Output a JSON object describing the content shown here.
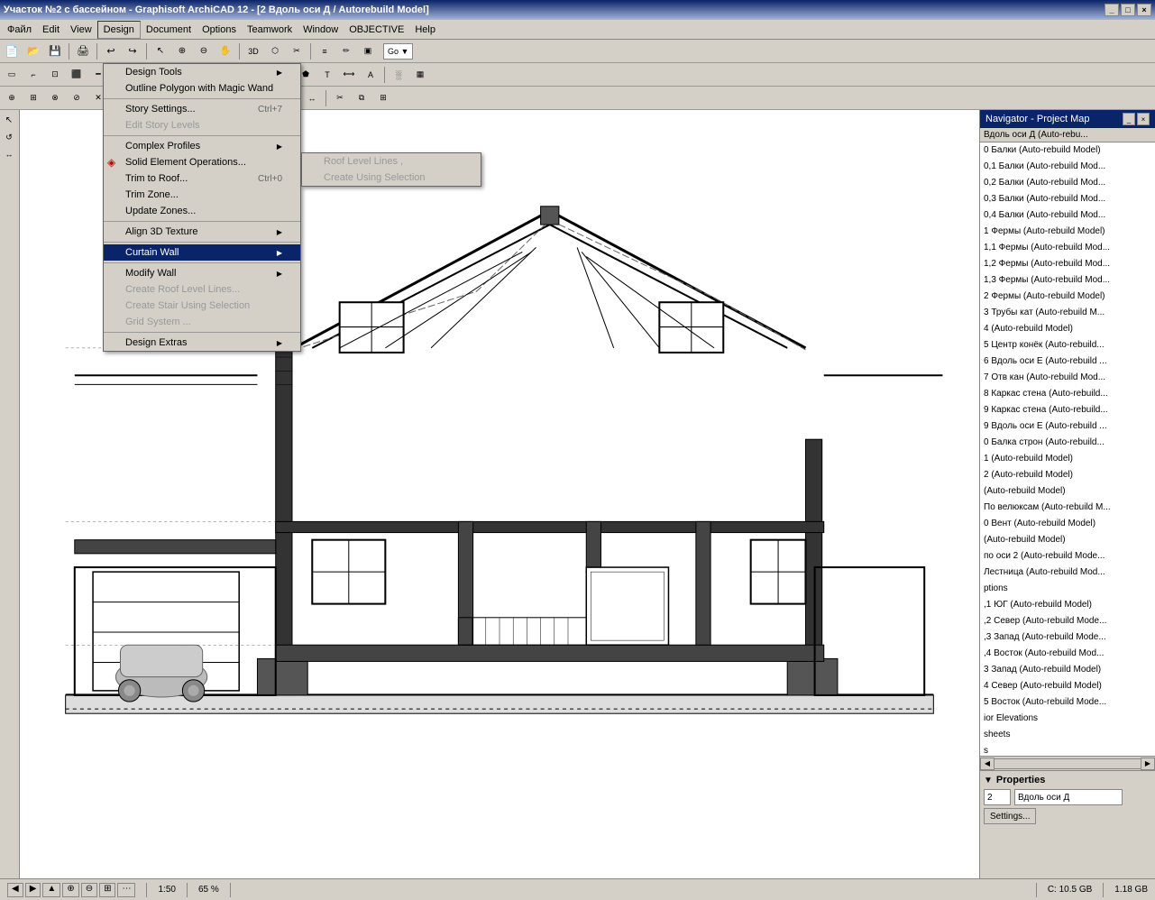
{
  "titlebar": {
    "title": "Участок №2 с бассейном - Graphisoft ArchiCAD 12 - [2 Вдоль оси Д / Autorebuild Model]",
    "buttons": [
      "_",
      "□",
      "×"
    ]
  },
  "menubar": {
    "items": [
      "Файл",
      "Edit",
      "View",
      "Design",
      "Document",
      "Options",
      "Teamwork",
      "Window",
      "OBJECTIVE",
      "Help"
    ],
    "active": "Design"
  },
  "design_menu": {
    "items": [
      {
        "label": "Design Tools",
        "arrow": true,
        "enabled": true,
        "shortcut": ""
      },
      {
        "label": "Outline Polygon with Magic Wand",
        "arrow": false,
        "enabled": true,
        "shortcut": ""
      },
      {
        "separator": true
      },
      {
        "label": "Story Settings...",
        "arrow": false,
        "enabled": true,
        "shortcut": "Ctrl+7"
      },
      {
        "label": "Edit Story Levels",
        "arrow": false,
        "enabled": false,
        "shortcut": ""
      },
      {
        "separator": true
      },
      {
        "label": "Complex Profiles",
        "arrow": true,
        "enabled": true,
        "shortcut": ""
      },
      {
        "label": "Solid Element Operations...",
        "arrow": false,
        "enabled": true,
        "shortcut": ""
      },
      {
        "label": "Trim to Roof...",
        "arrow": false,
        "enabled": true,
        "shortcut": "Ctrl+0"
      },
      {
        "label": "Trim Zone...",
        "arrow": false,
        "enabled": true,
        "shortcut": ""
      },
      {
        "label": "Update Zones...",
        "arrow": false,
        "enabled": true,
        "shortcut": ""
      },
      {
        "separator": true
      },
      {
        "label": "Align 3D Texture",
        "arrow": true,
        "enabled": true,
        "shortcut": ""
      },
      {
        "separator": true
      },
      {
        "label": "Curtain Wall",
        "arrow": true,
        "enabled": true,
        "shortcut": "",
        "highlighted": true
      },
      {
        "separator": true
      },
      {
        "label": "Modify Wall",
        "arrow": true,
        "enabled": true,
        "shortcut": ""
      },
      {
        "label": "Create Roof Level Lines...",
        "arrow": false,
        "enabled": false,
        "shortcut": ""
      },
      {
        "label": "Create Stair Using Selection",
        "arrow": false,
        "enabled": false,
        "shortcut": ""
      },
      {
        "label": "Grid System ...",
        "arrow": false,
        "enabled": false,
        "shortcut": ""
      },
      {
        "separator": true
      },
      {
        "label": "Design Extras",
        "arrow": true,
        "enabled": true,
        "shortcut": ""
      }
    ]
  },
  "curtain_wall_submenu": {
    "items": [
      {
        "label": "Roof Level Lines   ,",
        "enabled": false
      },
      {
        "label": "Create Using Selection",
        "enabled": false
      }
    ]
  },
  "navigator": {
    "title": "Navigator - Project Map",
    "current": "Вдоль оси Д (Auto-rebu...",
    "items": [
      "0 Балки (Auto-rebuild Model)",
      "0,1 Балки (Auto-rebuild Mod...",
      "0,2 Балки (Auto-rebuild Mod...",
      "0,3 Балки (Auto-rebuild Mod...",
      "0,4 Балки (Auto-rebuild Mod...",
      "1 Фермы (Auto-rebuild Model)",
      "1,1 Фермы (Auto-rebuild Mod...",
      "1,2 Фермы (Auto-rebuild Mod...",
      "1,3 Фермы (Auto-rebuild Mod...",
      "2 Фермы (Auto-rebuild Model)",
      "3 Трубы кат (Auto-rebuild M...",
      "4 (Auto-rebuild Model)",
      "5 Центр конёк (Auto-rebuild...",
      "6 Вдоль оси Е (Auto-rebuild ...",
      "7 Отв кан (Auto-rebuild Mod...",
      "8 Каркас стена (Auto-rebuild...",
      "9 Каркас стена (Auto-rebuild...",
      "9 Вдоль оси Е (Auto-rebuild ...",
      "0 Балка строн (Auto-rebuild...",
      "1 (Auto-rebuild Model)",
      "2 (Auto-rebuild Model)",
      " (Auto-rebuild Model)",
      "По велюксам (Auto-rebuild M...",
      "0 Вент (Auto-rebuild Model)",
      " (Auto-rebuild Model)",
      "по оси 2 (Auto-rebuild Mode...",
      "Лестница (Auto-rebuild Mod...",
      "ptions",
      ",1 ЮГ (Auto-rebuild Model)",
      ",2 Север (Auto-rebuild Mode...",
      ",3 Запад (Auto-rebuild Mode...",
      ",4 Восток (Auto-rebuild Mod...",
      "3 Запад (Auto-rebuild Model)",
      "4 Север (Auto-rebuild Model)",
      "5 Восток (Auto-rebuild Mode...",
      "ior Elevations",
      "sheets",
      "s"
    ]
  },
  "properties": {
    "header": "Properties",
    "label1": "2",
    "value1": "Вдоль оси Д",
    "settings_btn": "Settings..."
  },
  "statusbar": {
    "scale": "1:50",
    "zoom": "65 %",
    "disk_label": "C:",
    "disk_size": "10.5 GB",
    "mem_label": "1.18 GB",
    "nav_buttons": [
      "◀",
      "▶",
      "▲",
      "▼"
    ]
  },
  "toolbar_icons": {
    "standard": [
      "📁",
      "💾",
      "🖨",
      "✂",
      "📋",
      "↩",
      "↪",
      "🔍",
      "⊕",
      "⊖"
    ],
    "design": [
      "◻",
      "⬡",
      "⟳",
      "⬛",
      "▣",
      "☰",
      "⌂",
      "⊞"
    ]
  }
}
